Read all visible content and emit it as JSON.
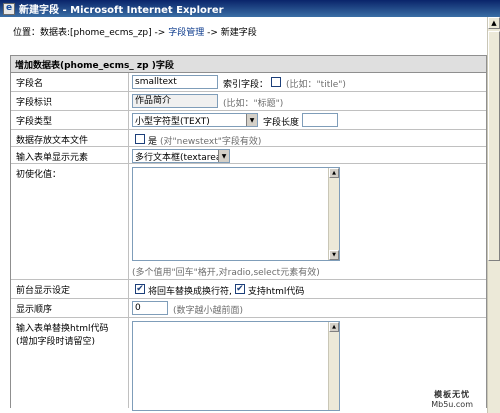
{
  "window": {
    "title": "新建字段 - Microsoft Internet Explorer"
  },
  "breadcrumb": {
    "prefix": "位置：数据表:[phome_ecms_zp] ->",
    "link": "字段管理",
    "current": "-> 新建字段"
  },
  "table": {
    "header": "增加数据表(phome_ecms_ zp )字段"
  },
  "fields": {
    "field_name": {
      "label": "字段名",
      "value": "smalltext",
      "index_label": "索引字段：",
      "index_hint": "(比如：\"title\")"
    },
    "field_id": {
      "label": "字段标识",
      "value": "作品简介",
      "hint": "(比如：\"标题\")"
    },
    "field_type": {
      "label": "字段类型",
      "value": "小型字符型(TEXT)",
      "length_label": "字段长度"
    },
    "store_text": {
      "label": "数据存放文本文件",
      "option": "是",
      "hint": "(对\"newstext\"字段有效)"
    },
    "input_element": {
      "label": "输入表单显示元素",
      "value": "多行文本框(textarea)"
    },
    "init_value": {
      "label": "初使化值：",
      "hint": "(多个值用\"回车\"格开,对radio,select元素有效)"
    },
    "front_display": {
      "label": "前台显示设定",
      "option1": "将回车替换成换行符,",
      "option2": "支持html代码"
    },
    "display_order": {
      "label": "显示顺序",
      "value": "0",
      "hint": "(数字越小越前面)"
    },
    "input_html": {
      "label_line1": "输入表单替换html代码",
      "label_line2": "(增加字段时请留空)"
    }
  },
  "watermark": {
    "line1": "模板无忧",
    "line2": "Mb5u.com"
  }
}
